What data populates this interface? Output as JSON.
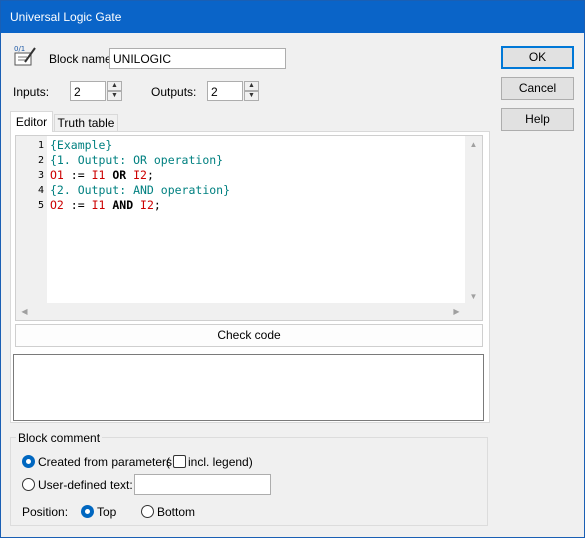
{
  "window": {
    "title": "Universal Logic Gate"
  },
  "block": {
    "name_label": "Block name:",
    "name_value": "UNILOGIC",
    "name_label_underline": "o"
  },
  "io": {
    "inputs_label": "Inputs:",
    "inputs_value": "2",
    "outputs_label": "Outputs:",
    "outputs_value": "2"
  },
  "tabs": [
    {
      "label": "Editor",
      "active": true
    },
    {
      "label": "Truth table",
      "active": false
    }
  ],
  "editor": {
    "line_numbers": [
      "1",
      "2",
      "3",
      "4",
      "5"
    ],
    "lines": [
      [
        {
          "text": "{Example}",
          "kind": "comment"
        }
      ],
      [
        {
          "text": "{1. Output: OR operation}",
          "kind": "comment"
        }
      ],
      [
        {
          "text": "O1",
          "kind": "var"
        },
        {
          "text": " := ",
          "kind": "op"
        },
        {
          "text": "I1",
          "kind": "var"
        },
        {
          "text": " OR ",
          "kind": "kw"
        },
        {
          "text": "I2",
          "kind": "var"
        },
        {
          "text": ";",
          "kind": "op"
        }
      ],
      [
        {
          "text": "{2. Output: AND operation}",
          "kind": "comment"
        }
      ],
      [
        {
          "text": "O2",
          "kind": "var"
        },
        {
          "text": " := ",
          "kind": "op"
        },
        {
          "text": "I1",
          "kind": "var"
        },
        {
          "text": " AND ",
          "kind": "kw"
        },
        {
          "text": "I2",
          "kind": "var"
        },
        {
          "text": ";",
          "kind": "op"
        }
      ]
    ]
  },
  "buttons": {
    "check_code": "Check code",
    "ok": "OK",
    "cancel": "Cancel",
    "help": "Help"
  },
  "comment": {
    "group_title": "Block comment",
    "created_from_params": "Created from parameters",
    "paren_open": "(",
    "incl_legend": "incl. legend)",
    "user_defined": "User-defined text:",
    "user_defined_value": "",
    "position_label": "Position:",
    "pos_top": "Top",
    "pos_bottom": "Bottom",
    "selected_source": "params",
    "selected_position": "top"
  },
  "colors": {
    "titlebar": "#0a64c8",
    "comment": "#008080",
    "variable": "#cc0000",
    "accent": "#0067c0"
  }
}
